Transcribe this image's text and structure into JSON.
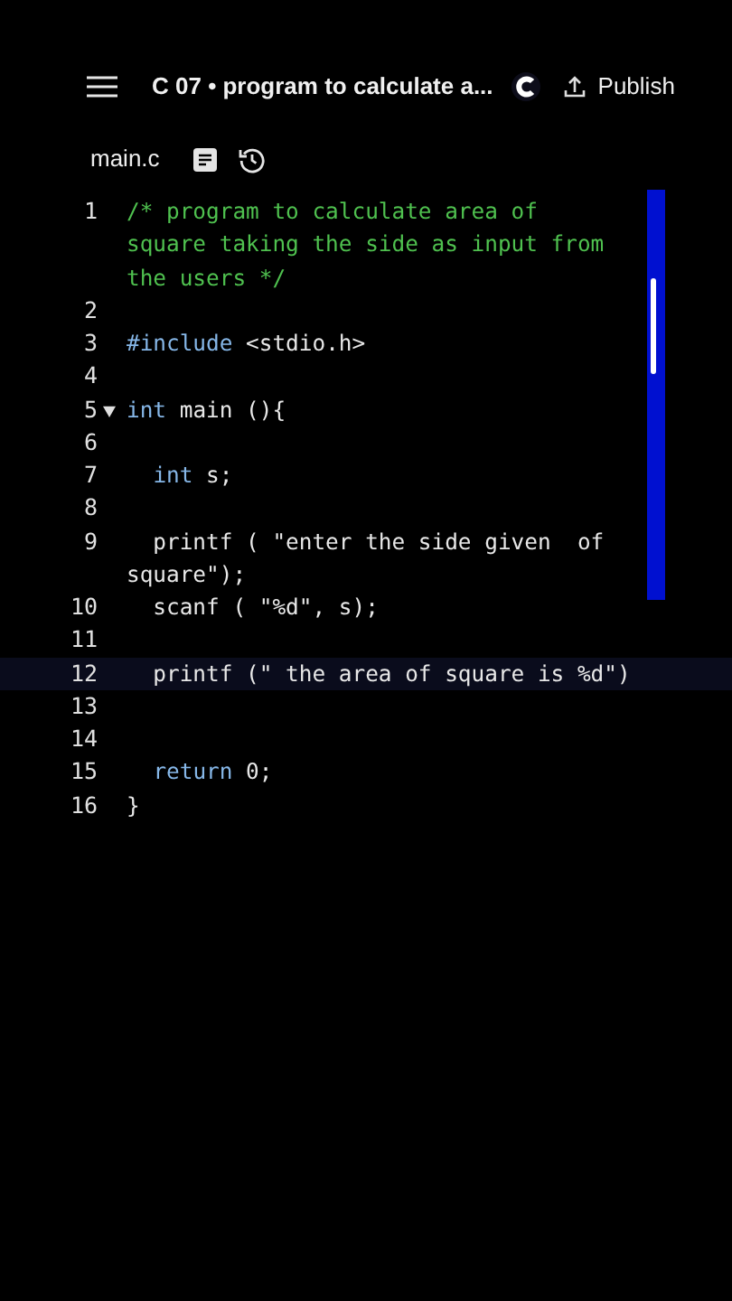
{
  "header": {
    "title": "C 07 • program to calculate a...",
    "publish_label": "Publish"
  },
  "file_bar": {
    "filename": "main.c"
  },
  "editor": {
    "lines": [
      {
        "number": "1",
        "selected": false,
        "rows": [
          [
            {
              "kind": "comment",
              "text": "/* program to calculate area of"
            }
          ],
          [
            {
              "kind": "comment",
              "text": "square taking the side as input from"
            }
          ],
          [
            {
              "kind": "comment",
              "text": "the users */"
            }
          ]
        ]
      },
      {
        "number": "2",
        "selected": false
      },
      {
        "number": "3",
        "selected": false,
        "rows": [
          [
            {
              "kind": "keyword",
              "text": "#include"
            },
            {
              "kind": "plain",
              "text": " <stdio.h>"
            }
          ]
        ]
      },
      {
        "number": "4",
        "selected": false
      },
      {
        "number": "5",
        "expanded": true,
        "selected": false,
        "rows": [
          [
            {
              "kind": "keyword",
              "text": "int"
            },
            {
              "kind": "plain",
              "text": " main (){"
            }
          ]
        ]
      },
      {
        "number": "6",
        "selected": false
      },
      {
        "number": "7",
        "selected": false,
        "rows": [
          [
            {
              "kind": "plain",
              "text": "  "
            },
            {
              "kind": "keyword",
              "text": "int"
            },
            {
              "kind": "plain",
              "text": " s;"
            }
          ]
        ]
      },
      {
        "number": "8",
        "selected": false
      },
      {
        "number": "9",
        "selected": false,
        "rows": [
          [
            {
              "kind": "plain",
              "text": "  printf ( \"enter the side given  of"
            }
          ],
          [
            {
              "kind": "plain",
              "text": "square\");"
            }
          ]
        ]
      },
      {
        "number": "10",
        "selected": false,
        "rows": [
          [
            {
              "kind": "plain",
              "text": "  scanf ( \"%d\", s);"
            }
          ]
        ]
      },
      {
        "number": "11",
        "selected": false
      },
      {
        "number": "12",
        "selected": true,
        "rows": [
          [
            {
              "kind": "plain",
              "text": "  printf (\" the area of square is %d\")"
            }
          ]
        ]
      },
      {
        "number": "13",
        "selected": false
      },
      {
        "number": "14",
        "selected": false
      },
      {
        "number": "15",
        "selected": false,
        "rows": [
          [
            {
              "kind": "plain",
              "text": "  "
            },
            {
              "kind": "keyword",
              "text": "return"
            },
            {
              "kind": "plain",
              "text": " 0;"
            }
          ]
        ]
      },
      {
        "number": "16",
        "selected": false,
        "rows": [
          [
            {
              "kind": "plain",
              "text": "}"
            }
          ]
        ]
      }
    ]
  }
}
